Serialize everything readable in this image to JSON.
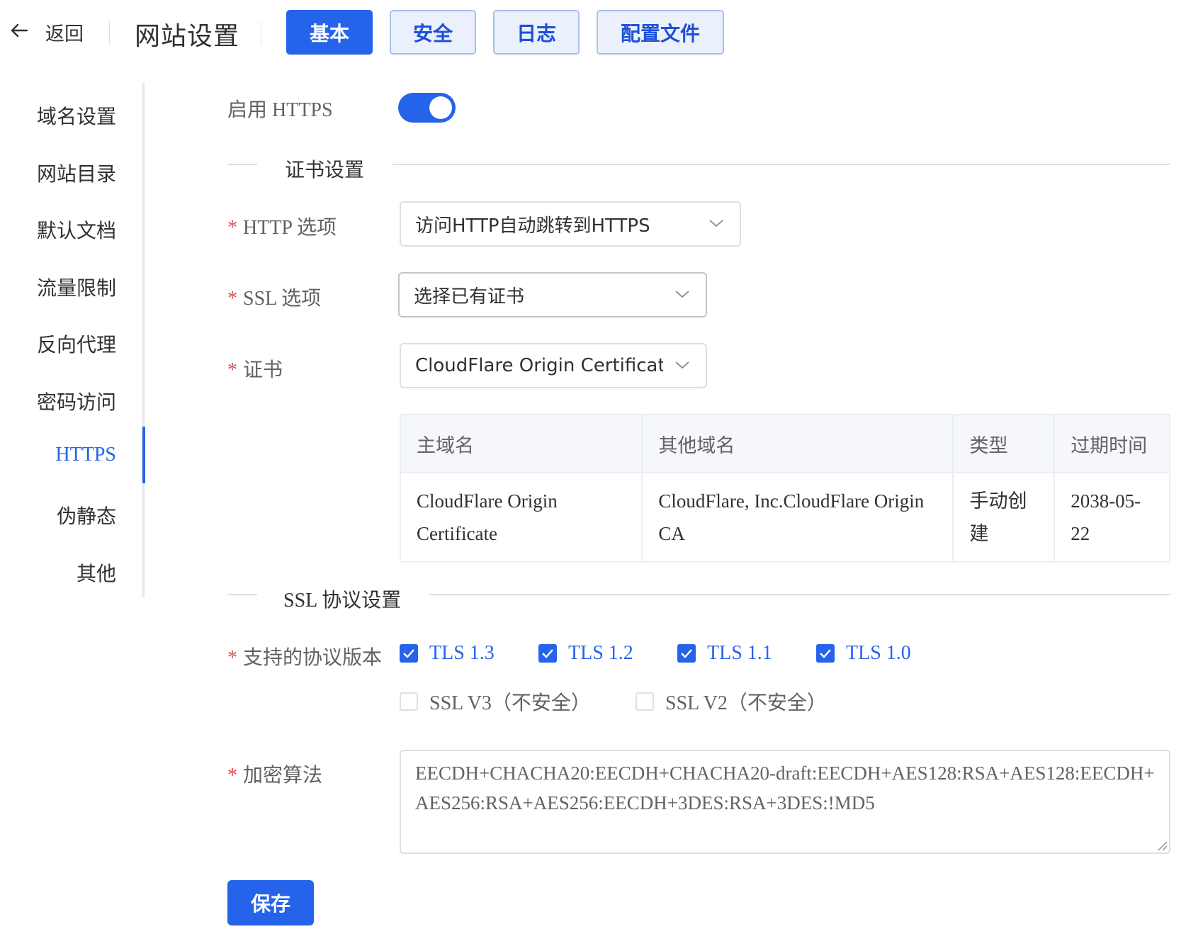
{
  "header": {
    "back_label": "返回",
    "title": "网站设置",
    "tabs": [
      {
        "label": "基本",
        "active": true
      },
      {
        "label": "安全",
        "active": false
      },
      {
        "label": "日志",
        "active": false
      },
      {
        "label": "配置文件",
        "active": false
      }
    ]
  },
  "sidebar": {
    "items": [
      {
        "label": "域名设置"
      },
      {
        "label": "网站目录"
      },
      {
        "label": "默认文档"
      },
      {
        "label": "流量限制"
      },
      {
        "label": "反向代理"
      },
      {
        "label": "密码访问"
      },
      {
        "label": "HTTPS",
        "active": true
      },
      {
        "label": "伪静态"
      },
      {
        "label": "其他"
      }
    ]
  },
  "form": {
    "enable_https_label": "启用 HTTPS",
    "enable_https": true,
    "cert_section_title": "证书设置",
    "http_option": {
      "required_mark": "*",
      "label": "HTTP 选项",
      "value": "访问HTTP自动跳转到HTTPS"
    },
    "ssl_option": {
      "required_mark": "*",
      "label": "SSL 选项",
      "value": "选择已有证书"
    },
    "certificate": {
      "required_mark": "*",
      "label": "证书",
      "value": "CloudFlare Origin Certificat"
    },
    "cert_table": {
      "headers": [
        "主域名",
        "其他域名",
        "类型",
        "过期时间"
      ],
      "row": {
        "main_domain": "CloudFlare Origin Certificate",
        "other_domains": "CloudFlare, Inc.CloudFlare Origin CA",
        "type": "手动创建",
        "expires": "2038-05-22"
      }
    },
    "ssl_section_title": "SSL 协议设置",
    "protocols": {
      "required_mark": "*",
      "label": "支持的协议版本",
      "options": [
        {
          "label": "TLS 1.3",
          "checked": true
        },
        {
          "label": "TLS 1.2",
          "checked": true
        },
        {
          "label": "TLS 1.1",
          "checked": true
        },
        {
          "label": "TLS 1.0",
          "checked": true
        },
        {
          "label": "SSL V3（不安全）",
          "checked": false
        },
        {
          "label": "SSL V2（不安全）",
          "checked": false
        }
      ]
    },
    "ciphers": {
      "required_mark": "*",
      "label": "加密算法",
      "value": "EECDH+CHACHA20:EECDH+CHACHA20-draft:EECDH+AES128:RSA+AES128:EECDH+AES256:RSA+AES256:EECDH+3DES:RSA+3DES:!MD5"
    },
    "save_label": "保存"
  },
  "colors": {
    "accent": "#2563eb",
    "tab_inactive_bg": "#eaf1fc",
    "required": "#e5484d",
    "border": "#dcdfe6"
  },
  "icons": {
    "back": "arrow-left-icon",
    "select": "chevron-down-icon",
    "check": "check-icon"
  }
}
